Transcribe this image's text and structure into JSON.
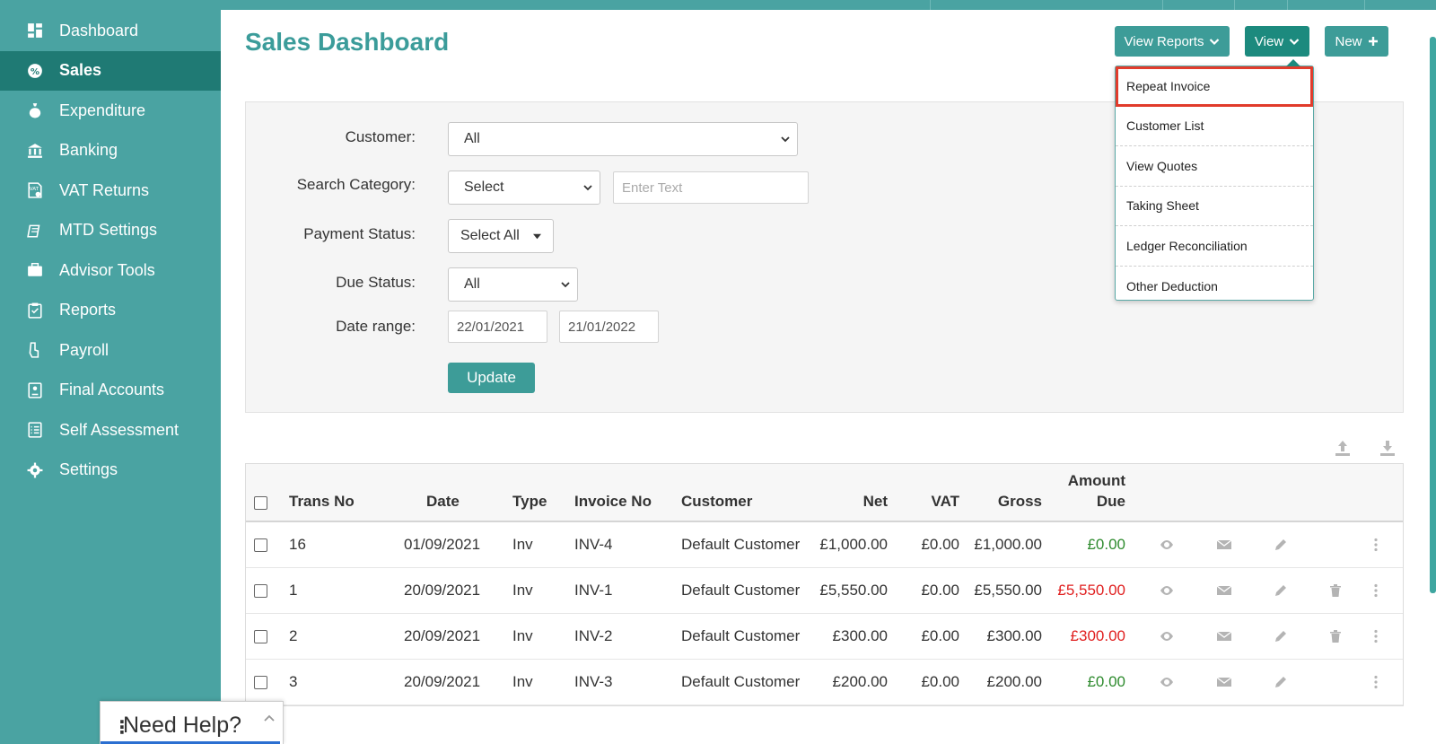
{
  "colors": {
    "sidebar": "#4aa3a2",
    "sidebar_active": "#1f7a74",
    "accent": "#3b9c9a",
    "highlight_border": "#e13b2b",
    "amount_zero": "#2e8b2e",
    "amount_due": "#e02020"
  },
  "sidebar": {
    "items": [
      {
        "label": "Dashboard",
        "icon": "dashboard-icon"
      },
      {
        "label": "Sales",
        "icon": "sales-icon",
        "active": true
      },
      {
        "label": "Expenditure",
        "icon": "money-bag-icon"
      },
      {
        "label": "Banking",
        "icon": "bank-icon"
      },
      {
        "label": "VAT Returns",
        "icon": "vat-icon"
      },
      {
        "label": "MTD Settings",
        "icon": "mtd-icon"
      },
      {
        "label": "Advisor Tools",
        "icon": "briefcase-icon"
      },
      {
        "label": "Reports",
        "icon": "clipboard-icon"
      },
      {
        "label": "Payroll",
        "icon": "payroll-icon"
      },
      {
        "label": "Final Accounts",
        "icon": "document-icon"
      },
      {
        "label": "Self Assessment",
        "icon": "checklist-icon"
      },
      {
        "label": "Settings",
        "icon": "gear-icon"
      }
    ]
  },
  "header": {
    "title": "Sales Dashboard",
    "view_reports_label": "View Reports",
    "view_label": "View",
    "new_label": "New"
  },
  "view_menu": {
    "items": [
      "Repeat Invoice",
      "Customer List",
      "View Quotes",
      "Taking Sheet",
      "Ledger Reconciliation",
      "Other Deduction"
    ]
  },
  "filters": {
    "customer_label": "Customer:",
    "customer_value": "All",
    "search_category_label": "Search Category:",
    "search_category_value": "Select",
    "search_text_placeholder": "Enter Text",
    "payment_status_label": "Payment Status:",
    "payment_status_value": "Select All",
    "due_status_label": "Due Status:",
    "due_status_value": "All",
    "date_range_label": "Date range:",
    "date_from": "22/01/2021",
    "date_to": "21/01/2022",
    "update_label": "Update"
  },
  "table": {
    "headers": {
      "trans_no": "Trans No",
      "date": "Date",
      "type": "Type",
      "invoice_no": "Invoice No",
      "customer": "Customer",
      "net": "Net",
      "vat": "VAT",
      "gross": "Gross",
      "amount_due_1": "Amount",
      "amount_due_2": "Due"
    },
    "rows": [
      {
        "trans_no": "16",
        "date": "01/09/2021",
        "type": "Inv",
        "invoice_no": "INV-4",
        "customer": "Default Customer",
        "net": "£1,000.00",
        "vat": "£0.00",
        "gross": "£1,000.00",
        "amount_due": "£0.00"
      },
      {
        "trans_no": "1",
        "date": "20/09/2021",
        "type": "Inv",
        "invoice_no": "INV-1",
        "customer": "Default Customer",
        "net": "£5,550.00",
        "vat": "£0.00",
        "gross": "£5,550.00",
        "amount_due": "£5,550.00"
      },
      {
        "trans_no": "2",
        "date": "20/09/2021",
        "type": "Inv",
        "invoice_no": "INV-2",
        "customer": "Default Customer",
        "net": "£300.00",
        "vat": "£0.00",
        "gross": "£300.00",
        "amount_due": "£300.00"
      },
      {
        "trans_no": "3",
        "date": "20/09/2021",
        "type": "Inv",
        "invoice_no": "INV-3",
        "customer": "Default Customer",
        "net": "£200.00",
        "vat": "£0.00",
        "gross": "£200.00",
        "amount_due": "£0.00"
      }
    ]
  },
  "help_widget": {
    "label": "Need Help?"
  }
}
